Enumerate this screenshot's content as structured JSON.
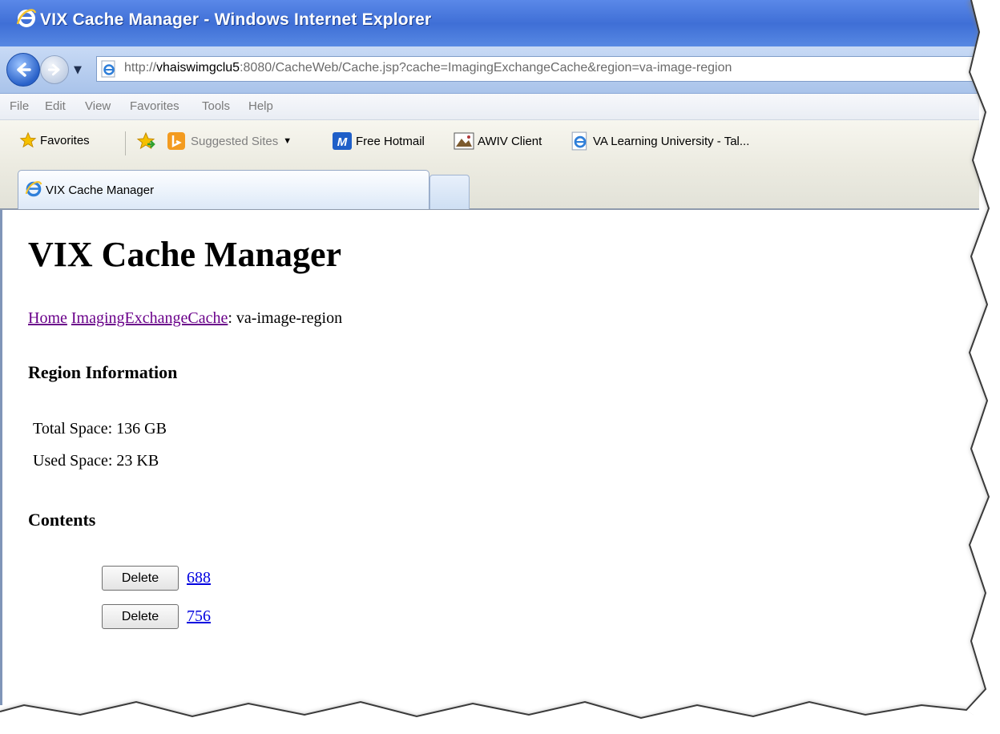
{
  "window": {
    "title": "VIX Cache Manager - Windows Internet Explorer"
  },
  "address_bar": {
    "url_prefix": "http://",
    "url_host": "vhaiswimgclu5",
    "url_rest": ":8080/CacheWeb/Cache.jsp?cache=ImagingExchangeCache&region=va-image-region"
  },
  "menu": [
    "File",
    "Edit",
    "View",
    "Favorites",
    "Tools",
    "Help"
  ],
  "favorites_bar": {
    "favorites_label": "Favorites",
    "items": [
      {
        "label": "Suggested Sites",
        "icon": "bing-icon"
      },
      {
        "label": "Free Hotmail",
        "icon": "msn-icon"
      },
      {
        "label": "AWIV Client",
        "icon": "image-icon"
      },
      {
        "label": "VA Learning University - Tal...",
        "icon": "ie-page-icon"
      }
    ]
  },
  "tab": {
    "label": "VIX Cache Manager"
  },
  "page": {
    "title": "VIX Cache Manager",
    "breadcrumb": {
      "home": "Home",
      "cache": "ImagingExchangeCache",
      "sep": ":",
      "region": " va-image-region"
    },
    "region_heading": "Region Information",
    "total_space": "Total Space: 136 GB",
    "used_space": "Used Space: 23 KB",
    "contents_heading": "Contents",
    "entries": [
      {
        "button": "Delete",
        "link": "688"
      },
      {
        "button": "Delete",
        "link": "756"
      }
    ]
  },
  "colors": {
    "titlebar": "#3f6fd6",
    "visited_link": "#6a008a",
    "link": "#0000e0"
  }
}
